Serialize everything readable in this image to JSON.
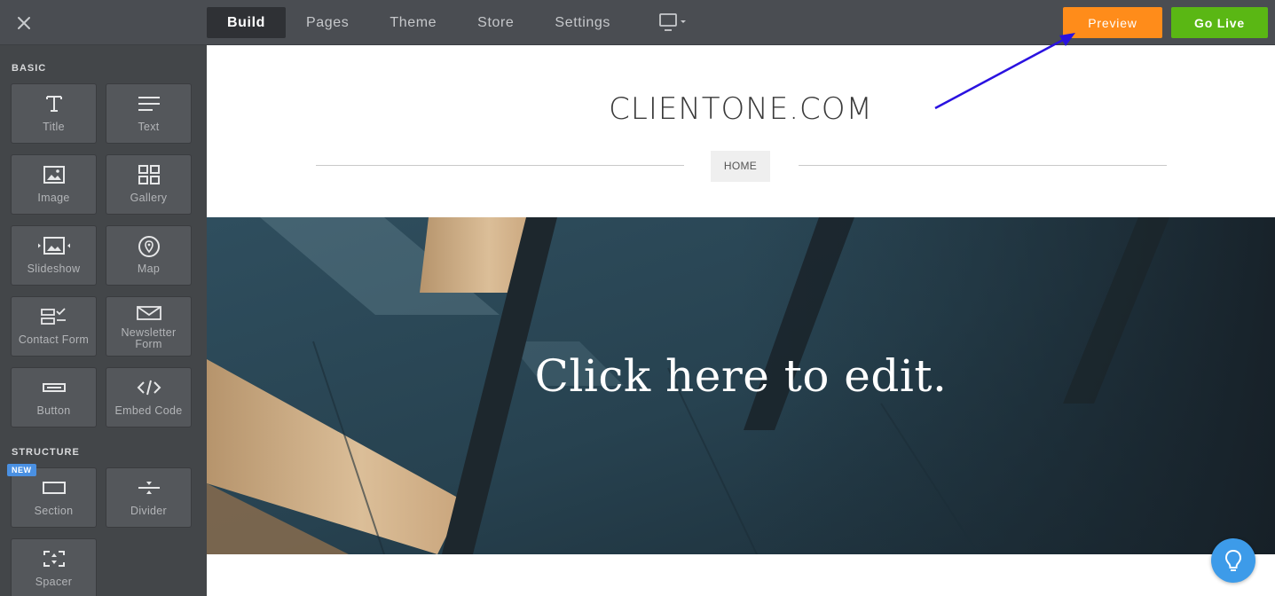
{
  "topbar": {
    "tabs": [
      {
        "label": "Build",
        "active": true
      },
      {
        "label": "Pages",
        "active": false
      },
      {
        "label": "Theme",
        "active": false
      },
      {
        "label": "Store",
        "active": false
      },
      {
        "label": "Settings",
        "active": false
      }
    ],
    "preview_label": "Preview",
    "golive_label": "Go Live",
    "colors": {
      "preview": "#ff8c1a",
      "golive": "#5ab714"
    }
  },
  "sidebar": {
    "basic_label": "BASIC",
    "structure_label": "STRUCTURE",
    "new_badge": "NEW",
    "basic_items": [
      {
        "label": "Title",
        "icon": "title-icon"
      },
      {
        "label": "Text",
        "icon": "text-lines-icon"
      },
      {
        "label": "Image",
        "icon": "image-icon"
      },
      {
        "label": "Gallery",
        "icon": "gallery-grid-icon"
      },
      {
        "label": "Slideshow",
        "icon": "slideshow-icon"
      },
      {
        "label": "Map",
        "icon": "map-pin-icon"
      },
      {
        "label": "Contact Form",
        "icon": "contact-form-icon"
      },
      {
        "label": "Newsletter Form",
        "icon": "envelope-icon"
      },
      {
        "label": "Button",
        "icon": "button-icon"
      },
      {
        "label": "Embed Code",
        "icon": "code-icon"
      }
    ],
    "structure_items": [
      {
        "label": "Section",
        "icon": "section-icon"
      },
      {
        "label": "Divider",
        "icon": "divider-icon"
      },
      {
        "label": "Spacer",
        "icon": "spacer-icon"
      }
    ]
  },
  "site": {
    "title": "CLIENTONE.COM",
    "nav_home": "HOME",
    "hero_text": "Click here to edit."
  },
  "annotation": {
    "color": "#2a12e0"
  }
}
